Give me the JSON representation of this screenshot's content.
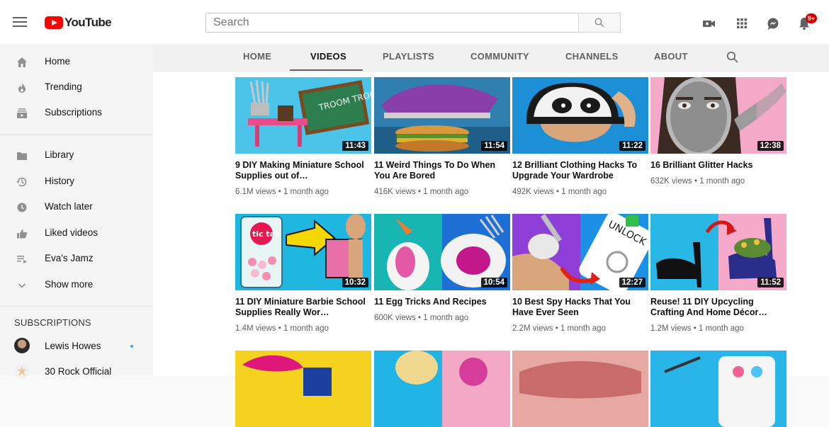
{
  "header": {
    "logo_text": "YouTube",
    "search_placeholder": "Search",
    "notification_count": "9+"
  },
  "sidebar": {
    "primary": [
      {
        "label": "Home",
        "icon": "home-icon"
      },
      {
        "label": "Trending",
        "icon": "trending-icon"
      },
      {
        "label": "Subscriptions",
        "icon": "subscriptions-icon"
      }
    ],
    "library": [
      {
        "label": "Library",
        "icon": "library-icon"
      },
      {
        "label": "History",
        "icon": "history-icon"
      },
      {
        "label": "Watch later",
        "icon": "watch-later-icon"
      },
      {
        "label": "Liked videos",
        "icon": "liked-videos-icon"
      },
      {
        "label": "Eva's Jamz",
        "icon": "playlist-icon"
      },
      {
        "label": "Show more",
        "icon": "chevron-down-icon"
      }
    ],
    "subscriptions_title": "SUBSCRIPTIONS",
    "subscriptions": [
      {
        "label": "Lewis Howes",
        "new_content": true
      },
      {
        "label": "30 Rock Official",
        "new_content": false
      }
    ]
  },
  "channel_tabs": {
    "items": [
      "HOME",
      "VIDEOS",
      "PLAYLISTS",
      "COMMUNITY",
      "CHANNELS",
      "ABOUT"
    ],
    "active": "VIDEOS"
  },
  "videos": [
    {
      "title": "9 DIY Making Miniature School Supplies out of…",
      "views": "6.1M views",
      "age": "1 month ago",
      "duration": "11:43"
    },
    {
      "title": "11 Weird Things To Do When You Are Bored",
      "views": "416K views",
      "age": "1 month ago",
      "duration": "11:54"
    },
    {
      "title": "12 Brilliant Clothing Hacks To Upgrade Your Wardrobe",
      "views": "492K views",
      "age": "1 month ago",
      "duration": "11:22"
    },
    {
      "title": "16 Brilliant Glitter Hacks",
      "views": "632K views",
      "age": "1 month ago",
      "duration": "12:38"
    },
    {
      "title": "11 DIY Miniature Barbie School Supplies Really Wor…",
      "views": "1.4M views",
      "age": "1 month ago",
      "duration": "10:32"
    },
    {
      "title": "11 Egg Tricks And Recipes",
      "views": "600K views",
      "age": "1 month ago",
      "duration": "10:54"
    },
    {
      "title": "10 Best Spy Hacks That You Have Ever Seen",
      "views": "2.2M views",
      "age": "1 month ago",
      "duration": "12:27"
    },
    {
      "title": "Reuse! 11 DIY Upcycling Crafting And Home Décor…",
      "views": "1.2M views",
      "age": "1 month ago",
      "duration": "11:52"
    }
  ],
  "thumbnail_text": {
    "v1_chalkboard": "TROOM TROOM",
    "v5_candy": "tic tac",
    "v7_phone": "UNLOCK"
  },
  "colors": {
    "brand_red": "#ff0000",
    "badge_red": "#cc0000",
    "live_dot": "#3ea6ff"
  }
}
